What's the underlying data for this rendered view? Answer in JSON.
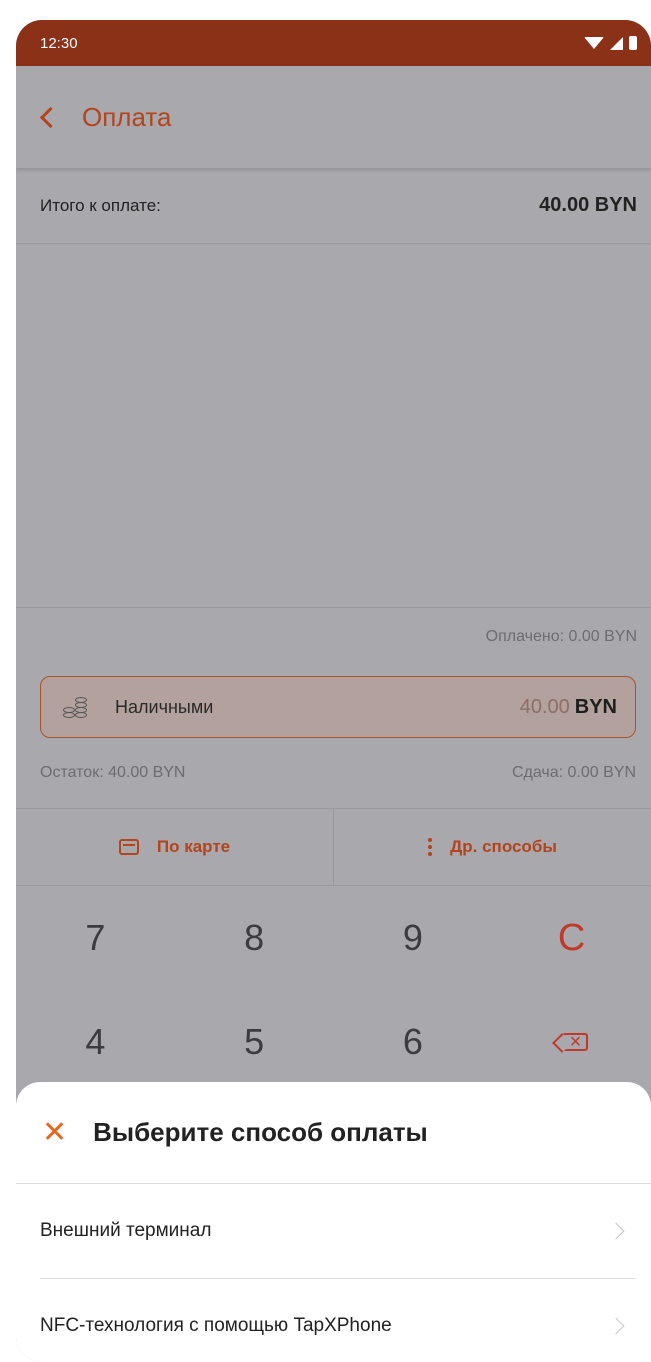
{
  "status_bar": {
    "time": "12:30"
  },
  "app_bar": {
    "title": "Оплата"
  },
  "total": {
    "label": "Итого к оплате:",
    "value": "40.00 BYN"
  },
  "paid": "Оплачено: 0.00 BYN",
  "cash": {
    "label": "Наличными",
    "amount": "40.00",
    "currency": "BYN"
  },
  "balance": {
    "remaining": "Остаток: 40.00 BYN",
    "change": "Сдача: 0.00 BYN"
  },
  "methods": {
    "card": "По карте",
    "other": "Др. способы"
  },
  "keypad": {
    "k7": "7",
    "k8": "8",
    "k9": "9",
    "clear": "C",
    "k4": "4",
    "k5": "5",
    "k6": "6"
  },
  "sheet": {
    "title": "Выберите способ оплаты",
    "items": [
      {
        "label": "Внешний терминал"
      },
      {
        "label": "NFC-технология с помощью TapXPhone"
      }
    ]
  },
  "colors": {
    "accent": "#b3441d",
    "status_bar": "#8a3118",
    "close": "#e8661c"
  }
}
